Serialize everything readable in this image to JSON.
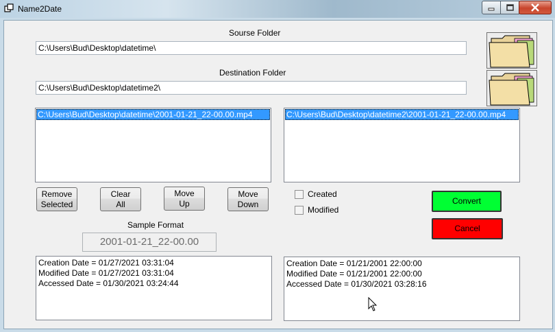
{
  "window": {
    "title": "Name2Date"
  },
  "source": {
    "label": "Sourse Folder",
    "value": "C:\\Users\\Bud\\Desktop\\datetime\\"
  },
  "destination": {
    "label": "Destination Folder",
    "value": "C:\\Users\\Bud\\Desktop\\datetime2\\"
  },
  "source_list": {
    "items": [
      "C:\\Users\\Bud\\Desktop\\datetime\\2001-01-21_22-00.00.mp4"
    ]
  },
  "dest_list": {
    "items": [
      "C:\\Users\\Bud\\Desktop\\datetime2\\2001-01-21_22-00.00.mp4"
    ]
  },
  "buttons": {
    "remove_selected": "Remove\nSelected",
    "clear_all": "Clear\nAll",
    "move_up": "Move\nUp",
    "move_down": "Move\nDown",
    "convert": "Convert",
    "cancel": "Cancel"
  },
  "options": {
    "created": "Created",
    "modified": "Modified",
    "created_checked": false,
    "modified_checked": false
  },
  "sample": {
    "label": "Sample Format",
    "value": "2001-01-21_22-00.00"
  },
  "source_info": {
    "line1": "Creation Date = 01/27/2021 03:31:04",
    "line2": "Modified Date = 01/27/2021 03:31:04",
    "line3": "Accessed Date = 01/30/2021 03:24:44"
  },
  "dest_info": {
    "line1": "Creation Date = 01/21/2001 22:00:00",
    "line2": "Modified Date = 01/21/2001 22:00:00",
    "line3": "Accessed Date = 01/30/2021 03:28:16"
  },
  "colors": {
    "convert": "#00ff33",
    "cancel": "#ff0000",
    "selection": "#3399ff"
  },
  "icons": {
    "folder": "folder-icon",
    "app": "window-app-icon",
    "cursor": "mouse-pointer-icon"
  }
}
